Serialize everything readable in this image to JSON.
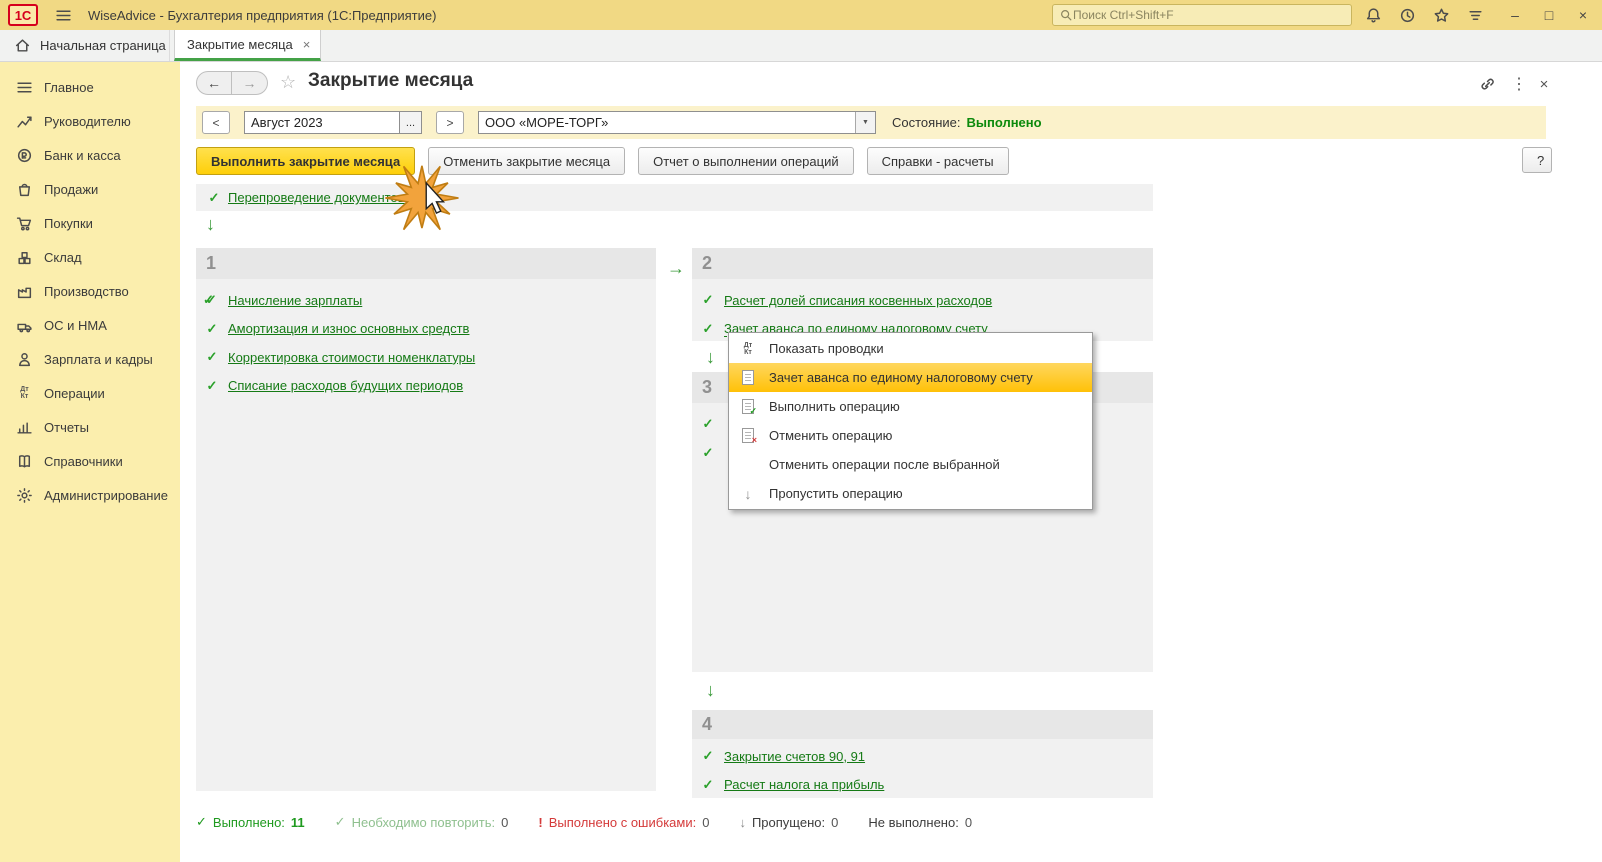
{
  "titlebar": {
    "logo_text": "1С",
    "app_title": "WiseAdvice - Бухгалтерия предприятия  (1С:Предприятие)",
    "search_placeholder": "Поиск Ctrl+Shift+F"
  },
  "tabbar": {
    "home_tab": "Начальная страница",
    "active_tab": "Закрытие месяца"
  },
  "sidebar": {
    "items": [
      {
        "label": "Главное"
      },
      {
        "label": "Руководителю"
      },
      {
        "label": "Банк и касса"
      },
      {
        "label": "Продажи"
      },
      {
        "label": "Покупки"
      },
      {
        "label": "Склад"
      },
      {
        "label": "Производство"
      },
      {
        "label": "ОС и НМА"
      },
      {
        "label": "Зарплата и кадры"
      },
      {
        "label": "Операции"
      },
      {
        "label": "Отчеты"
      },
      {
        "label": "Справочники"
      },
      {
        "label": "Администрирование"
      }
    ]
  },
  "header": {
    "title": "Закрытие месяца"
  },
  "toolbar": {
    "prev_button": "<",
    "period_value": "Август 2023",
    "ellipsis_button": "...",
    "next_button": ">",
    "org_value": "ООО «МОРЕ-ТОРГ»",
    "state_label": "Состояние:",
    "state_value": "Выполнено"
  },
  "actions": {
    "run": "Выполнить закрытие месяца",
    "cancel": "Отменить закрытие месяца",
    "report": "Отчет о выполнении операций",
    "refs": "Справки - расчеты",
    "help": "?"
  },
  "reposting": {
    "link": "Перепроведение документов"
  },
  "blocks": {
    "b1": {
      "num": "1",
      "items": [
        {
          "label": "Начисление зарплаты"
        },
        {
          "label": "Амортизация и износ основных средств"
        },
        {
          "label": "Корректировка стоимости номенклатуры"
        },
        {
          "label": "Списание расходов будущих периодов"
        }
      ]
    },
    "b2": {
      "num": "2",
      "items": [
        {
          "label": "Расчет долей списания косвенных расходов"
        },
        {
          "label": "Зачет аванса по единому налоговому счету"
        }
      ]
    },
    "b3": {
      "num": "3"
    },
    "b4": {
      "num": "4",
      "items": [
        {
          "label": "Закрытие счетов 90, 91"
        },
        {
          "label": "Расчет налога на прибыль"
        }
      ]
    }
  },
  "context_menu": {
    "items": [
      {
        "label": "Показать проводки"
      },
      {
        "label": "Зачет аванса по единому налоговому счету"
      },
      {
        "label": "Выполнить операцию"
      },
      {
        "label": "Отменить операцию"
      },
      {
        "label": "Отменить операции после выбранной"
      },
      {
        "label": "Пропустить операцию"
      }
    ]
  },
  "statusbar": {
    "done_label": "Выполнено:",
    "done_value": "11",
    "repeat_label": "Необходимо повторить:",
    "repeat_value": "0",
    "errors_label": "Выполнено с ошибками:",
    "errors_value": "0",
    "skipped_label": "Пропущено:",
    "skipped_value": "0",
    "notdone_label": "Не выполнено:",
    "notdone_value": "0"
  },
  "icons": {
    "check": "✓",
    "double_check": "✓✓",
    "arrow_down": "↓",
    "arrow_right": "→",
    "back_arrow": "←",
    "forward_arrow": "→",
    "star": "☆",
    "dots": "⋮",
    "close": "×",
    "minimize": "–",
    "maximize": "□",
    "dropdown": "▼",
    "error_mark": "!",
    "dt": "Дт",
    "kt": "Кт"
  },
  "colors": {
    "titlebar_yellow": "#f1d984",
    "sidebar_yellow": "#fbeead",
    "toolbar_yellow": "#fbf2cb",
    "primary_button_yellow": "#fecf09",
    "link_green": "#157a15",
    "state_green": "#0c8a0c",
    "menu_highlight": "#ffc107",
    "error_red": "#d43a3a",
    "block_gray": "#f1f1f1"
  }
}
